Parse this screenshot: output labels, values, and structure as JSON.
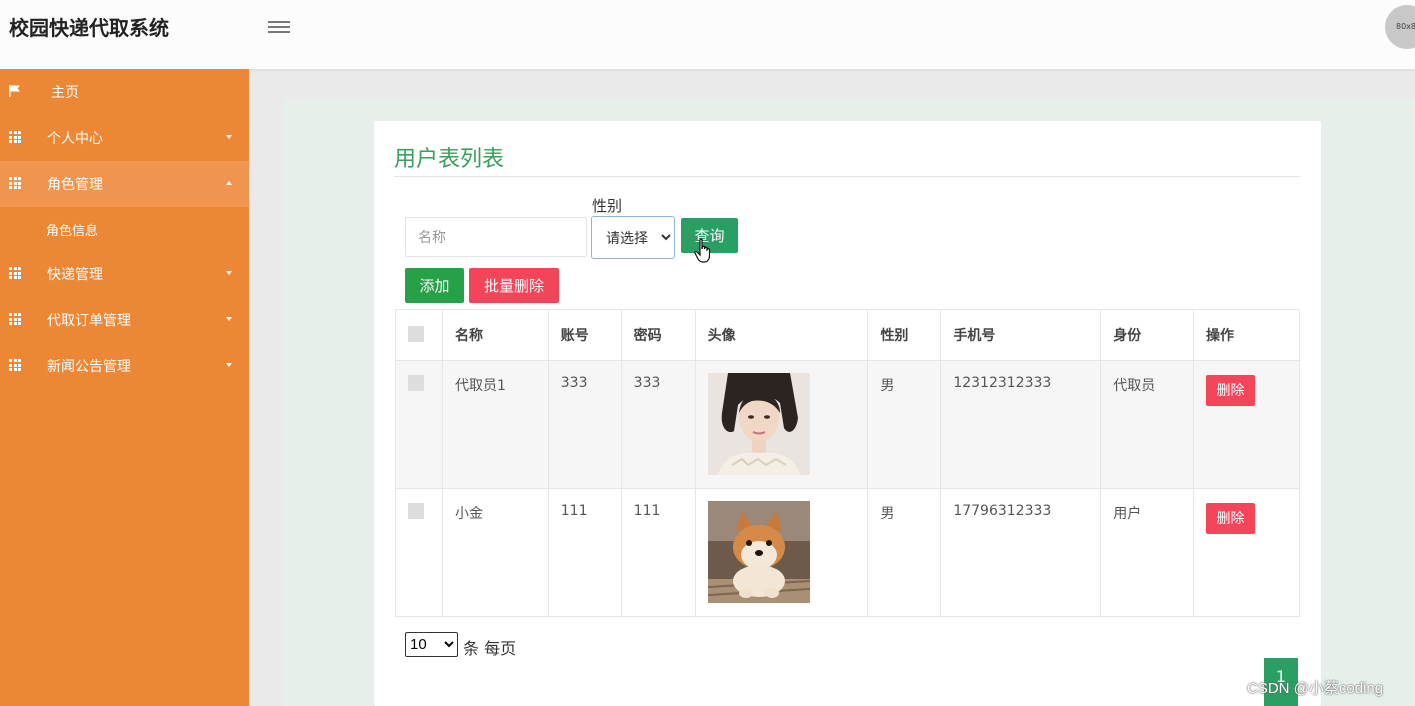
{
  "header": {
    "brand": "校园快递代取系统",
    "avatar_text": "80x80"
  },
  "sidebar": {
    "items": [
      {
        "label": "主页",
        "icon": "flag-icon"
      },
      {
        "label": "个人中心",
        "icon": "grid-icon"
      },
      {
        "label": "角色管理",
        "icon": "grid-icon",
        "expanded": true
      },
      {
        "label": "快递管理",
        "icon": "grid-icon"
      },
      {
        "label": "代取订单管理",
        "icon": "grid-icon"
      },
      {
        "label": "新闻公告管理",
        "icon": "grid-icon"
      }
    ],
    "subitems": [
      {
        "label": "角色信息"
      }
    ]
  },
  "main": {
    "title": "用户表列表",
    "search": {
      "name_placeholder": "名称",
      "gender_label": "性别",
      "gender_selected": "请选择",
      "query_label": "查询"
    },
    "actions": {
      "add_label": "添加",
      "batch_delete_label": "批量删除"
    },
    "table": {
      "columns": [
        "名称",
        "账号",
        "密码",
        "头像",
        "性别",
        "手机号",
        "身份",
        "操作"
      ],
      "rows": [
        {
          "name": "代取员1",
          "account": "333",
          "password": "333",
          "avatar": "woman-portrait",
          "gender": "男",
          "phone": "12312312333",
          "role": "代取员",
          "action": "删除"
        },
        {
          "name": "小金",
          "account": "111",
          "password": "111",
          "avatar": "shiba-dog-photo",
          "gender": "男",
          "phone": "17796312333",
          "role": "用户",
          "action": "删除"
        }
      ]
    },
    "pagination": {
      "page_size": "10",
      "page_size_label": "条 每页",
      "current_page": "1"
    }
  },
  "watermark": "CSDN @小蔡coding",
  "colors": {
    "sidebar": "#ec8736",
    "title": "#3aa05b",
    "primary": "#2a9f63",
    "danger": "#f4455a"
  }
}
